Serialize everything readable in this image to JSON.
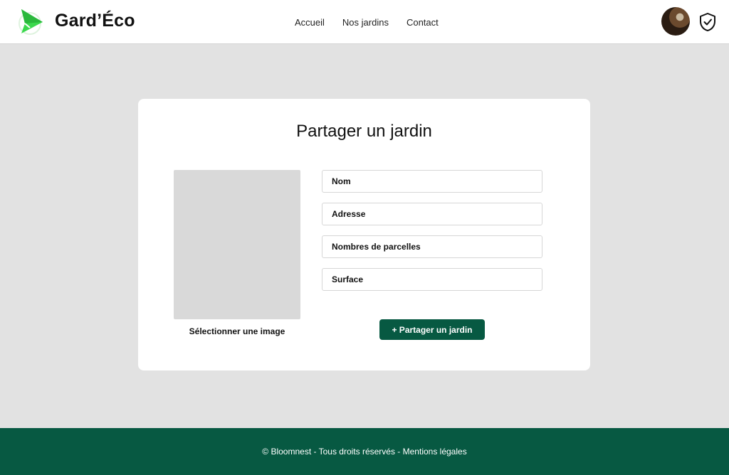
{
  "header": {
    "brand": "Gard’Éco",
    "nav": [
      "Accueil",
      "Nos jardins",
      "Contact"
    ]
  },
  "form": {
    "title": "Partager un jardin",
    "image_label": "Sélectionner une image",
    "fields": [
      {
        "placeholder": "Nom",
        "value": ""
      },
      {
        "placeholder": "Adresse",
        "value": ""
      },
      {
        "placeholder": "Nombres de parcelles",
        "value": ""
      },
      {
        "placeholder": "Surface",
        "value": ""
      }
    ],
    "submit_label": "+ Partager un jardin"
  },
  "footer": {
    "text": "© Bloomnest - Tous droits réservés - Mentions légales"
  },
  "colors": {
    "accent": "#075942",
    "logo_green": "#2ecc40",
    "page_bg": "#e2e2e2"
  },
  "icons": {
    "logo": "paper-plane-leaf-icon",
    "avatar": "user-avatar",
    "shield": "shield-check-icon"
  }
}
